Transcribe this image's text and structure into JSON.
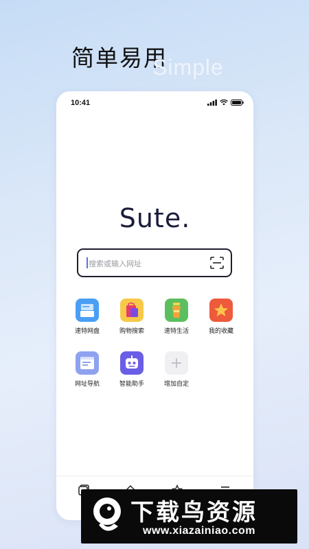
{
  "promo": {
    "headline": "简单易用",
    "subheadline": "Simple"
  },
  "status_bar": {
    "time": "10:41"
  },
  "home": {
    "logo_text": "Sute.",
    "search_placeholder": "搜索或输入网址"
  },
  "shortcuts": [
    {
      "label": "速特网盘",
      "icon": "cloud-disk-icon",
      "color": "#4a9ff5"
    },
    {
      "label": "购物搜索",
      "icon": "shopping-bag-icon",
      "color": "#f7c948"
    },
    {
      "label": "速特生活",
      "icon": "drink-cup-icon",
      "color": "#5cbf5f"
    },
    {
      "label": "我的收藏",
      "icon": "star-icon",
      "color": "#ee5a3c"
    },
    {
      "label": "网址导航",
      "icon": "browser-window-icon",
      "color": "#8fa2ef"
    },
    {
      "label": "智能助手",
      "icon": "robot-icon",
      "color": "#6b5ee6"
    },
    {
      "label": "增加自定",
      "icon": "plus-icon",
      "color": "#f0f0f3"
    }
  ],
  "bottom_nav": [
    "tabs-icon",
    "home-icon",
    "star-outline-icon",
    "menu-icon"
  ],
  "watermark": {
    "title": "下载鸟资源",
    "url": "www.xiazainiao.com"
  }
}
